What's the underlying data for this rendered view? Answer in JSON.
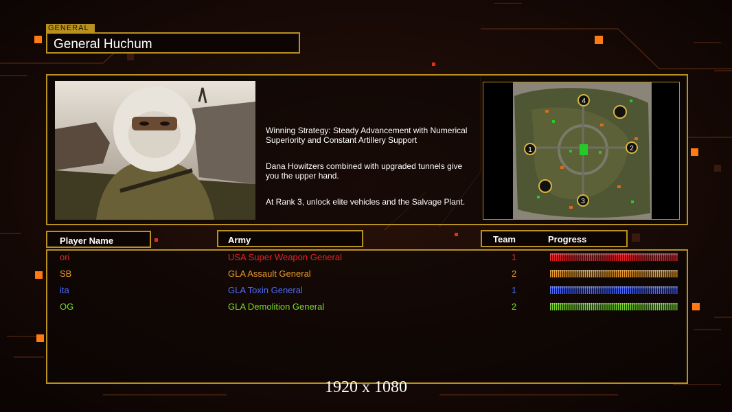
{
  "header": {
    "tag": "GENERAL",
    "name": "General Huchum"
  },
  "briefing": {
    "line1": "Winning Strategy: Steady Advancement with Numerical\n Superiority and Constant Artillery Support",
    "line2": "Dana Howitzers combined with upgraded tunnels give\n you the upper hand.",
    "line3": "At Rank 3, unlock elite vehicles and the Salvage Plant."
  },
  "map": {
    "slots": [
      "1",
      "2",
      "3",
      "4"
    ]
  },
  "columns": {
    "player": "Player Name",
    "army": "Army",
    "team": "Team",
    "progress": "Progress"
  },
  "players": [
    {
      "name": "ori",
      "army": "USA Super Weapon General",
      "team": "1",
      "color": "#e8222a"
    },
    {
      "name": "SB",
      "army": "GLA Assault General",
      "team": "2",
      "color": "#e89a2a"
    },
    {
      "name": "ita",
      "army": "GLA Toxin General",
      "team": "1",
      "color": "#4d6bff"
    },
    {
      "name": "OG",
      "army": "GLA Demolition General",
      "team": "2",
      "color": "#7ed82a"
    }
  ],
  "caption": "1920 x 1080",
  "colors": {
    "accent": "#b8911f",
    "background": "#120806"
  }
}
